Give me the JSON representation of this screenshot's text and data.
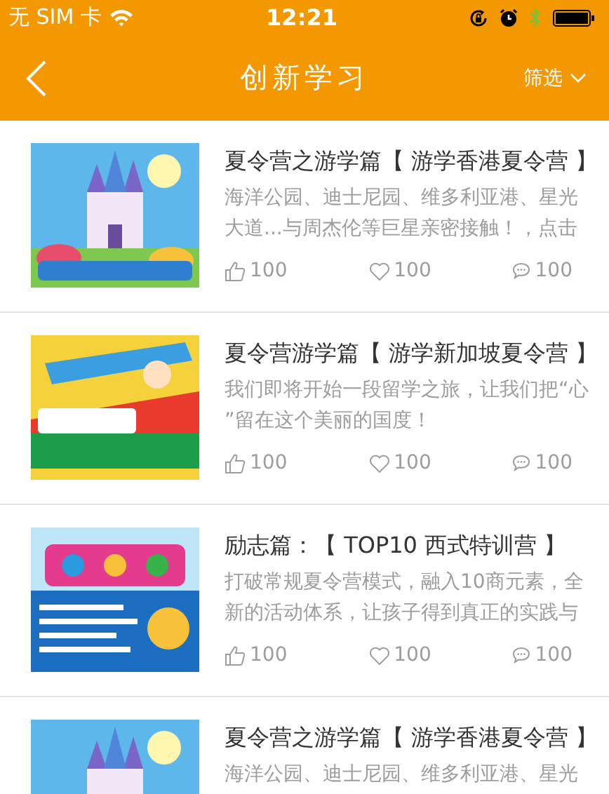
{
  "status_bar": {
    "carrier": "无 SIM 卡",
    "time": "12:21"
  },
  "nav_bar": {
    "title": "创新学习",
    "filter": "筛选"
  },
  "articles": [
    {
      "title": "夏令营之游学篇【 游学香港夏令营 】",
      "description": "海洋公园、迪士尼园、维多利亚港、星光大道...与周杰伦等巨星亲密接触！，点击",
      "likes": "100",
      "favorites": "100",
      "comments": "100"
    },
    {
      "title": "夏令营游学篇【 游学新加坡夏令营 】",
      "description": "我们即将开始一段留学之旅，让我们把“心”留在这个美丽的国度！",
      "likes": "100",
      "favorites": "100",
      "comments": "100"
    },
    {
      "title": "励志篇：【 TOP10  西式特训营 】",
      "description": "打破常规夏令营模式，融入10商元素，全新的活动体系，让孩子得到真正的实践与",
      "likes": "100",
      "favorites": "100",
      "comments": "100"
    },
    {
      "title": "夏令营之游学篇【 游学香港夏令营 】",
      "description": "海洋公园、迪士尼园、维多利亚港、星光"
    }
  ]
}
